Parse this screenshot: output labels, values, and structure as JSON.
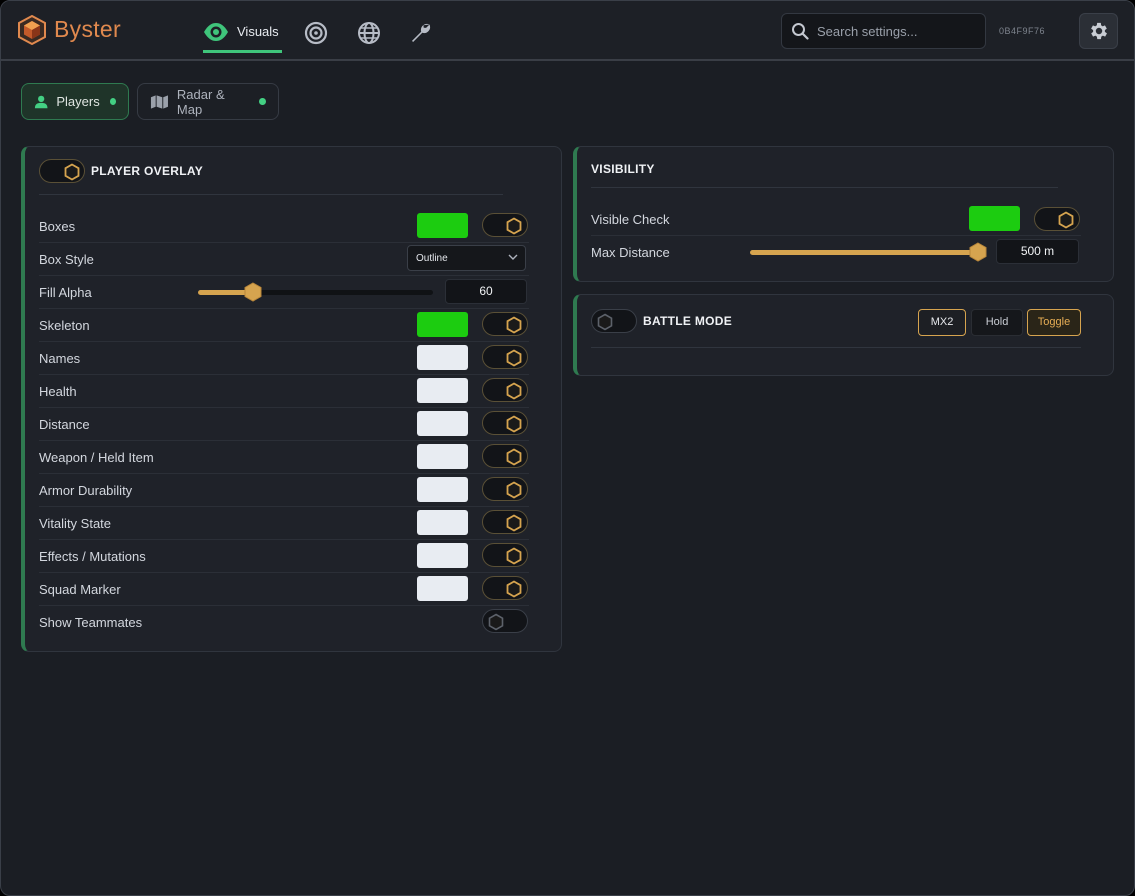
{
  "app": {
    "name": "Byster",
    "session_id": "0B4F9F76"
  },
  "colors": {
    "accent_green": "#3fc57b",
    "accent_gold": "#d6a44f",
    "brand_orange": "#e0894e",
    "swatch_green": "#1ccc10",
    "swatch_white": "#e8ecf2"
  },
  "header": {
    "tabs": [
      {
        "label": "Visuals",
        "icon": "eye-icon",
        "active": true
      },
      {
        "label": "",
        "icon": "target-icon",
        "active": false
      },
      {
        "label": "",
        "icon": "globe-icon",
        "active": false
      },
      {
        "label": "",
        "icon": "wrench-icon",
        "active": false
      }
    ],
    "search": {
      "placeholder": "Search settings..."
    }
  },
  "subtabs": [
    {
      "label": "Players",
      "icon": "user-icon",
      "active": true
    },
    {
      "label": "Radar & Map",
      "icon": "map-icon",
      "active": false
    }
  ],
  "player_overlay": {
    "title": "PLAYER OVERLAY",
    "enabled": true,
    "rows": [
      {
        "label": "Boxes",
        "swatch": "green",
        "toggle": true
      },
      {
        "label": "Box Style",
        "dropdown": "Outline"
      },
      {
        "label": "Fill Alpha",
        "slider": 60,
        "value": "60"
      },
      {
        "label": "Skeleton",
        "swatch": "green",
        "toggle": true
      },
      {
        "label": "Names",
        "swatch": "white",
        "toggle": true
      },
      {
        "label": "Health",
        "swatch": "white",
        "toggle": true
      },
      {
        "label": "Distance",
        "swatch": "white",
        "toggle": true
      },
      {
        "label": "Weapon / Held Item",
        "swatch": "white",
        "toggle": true
      },
      {
        "label": "Armor Durability",
        "swatch": "white",
        "toggle": true
      },
      {
        "label": "Vitality State",
        "swatch": "white",
        "toggle": true
      },
      {
        "label": "Effects / Mutations",
        "swatch": "white",
        "toggle": true
      },
      {
        "label": "Squad Marker",
        "swatch": "white",
        "toggle": true
      },
      {
        "label": "Show Teammates",
        "toggle": false
      }
    ]
  },
  "visibility": {
    "title": "VISIBILITY",
    "visible_check_label": "Visible Check",
    "visible_check_toggle": true,
    "max_distance_label": "Max Distance",
    "max_distance_value": "500 m",
    "max_distance_fraction": 1.0
  },
  "battle_mode": {
    "title": "BATTLE MODE",
    "enabled": false,
    "buttons": [
      {
        "label": "MX2",
        "style": "outlined"
      },
      {
        "label": "Hold",
        "style": "plain"
      },
      {
        "label": "Toggle",
        "style": "selected"
      }
    ]
  }
}
